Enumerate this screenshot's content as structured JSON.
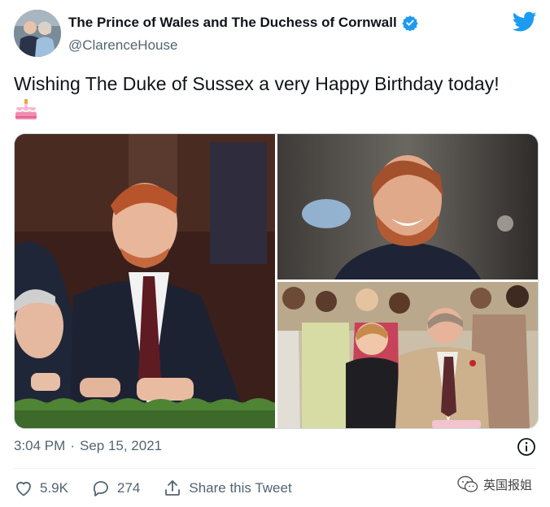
{
  "author": {
    "display_name": "The Prince of Wales and The Duchess of Cornwall",
    "handle": "@ClarenceHouse",
    "avatar_icon": "avatar-photo",
    "verified_icon": "verified-badge-icon",
    "verified_color": "#1d9bf0"
  },
  "brand": {
    "logo_icon": "twitter-bird-icon",
    "color": "#1d9bf0"
  },
  "tweet": {
    "text": "Wishing The Duke of Sussex a very Happy Birthday today!",
    "emoji_icon": "birthday-cake-emoji"
  },
  "media": {
    "photos": [
      {
        "icon": "photo-two-men-laughing"
      },
      {
        "icon": "photo-smiling-man-portrait"
      },
      {
        "icon": "photo-crowd-cutting-cake"
      }
    ]
  },
  "meta": {
    "time": "3:04 PM",
    "separator": "·",
    "date": "Sep 15, 2021",
    "info_icon": "info-icon"
  },
  "actions": {
    "like_count": "5.9K",
    "reply_count": "274",
    "share_label": "Share this Tweet",
    "text_color": "#536471"
  },
  "watermark": {
    "text": "英国报姐",
    "icon": "wechat-icon"
  }
}
